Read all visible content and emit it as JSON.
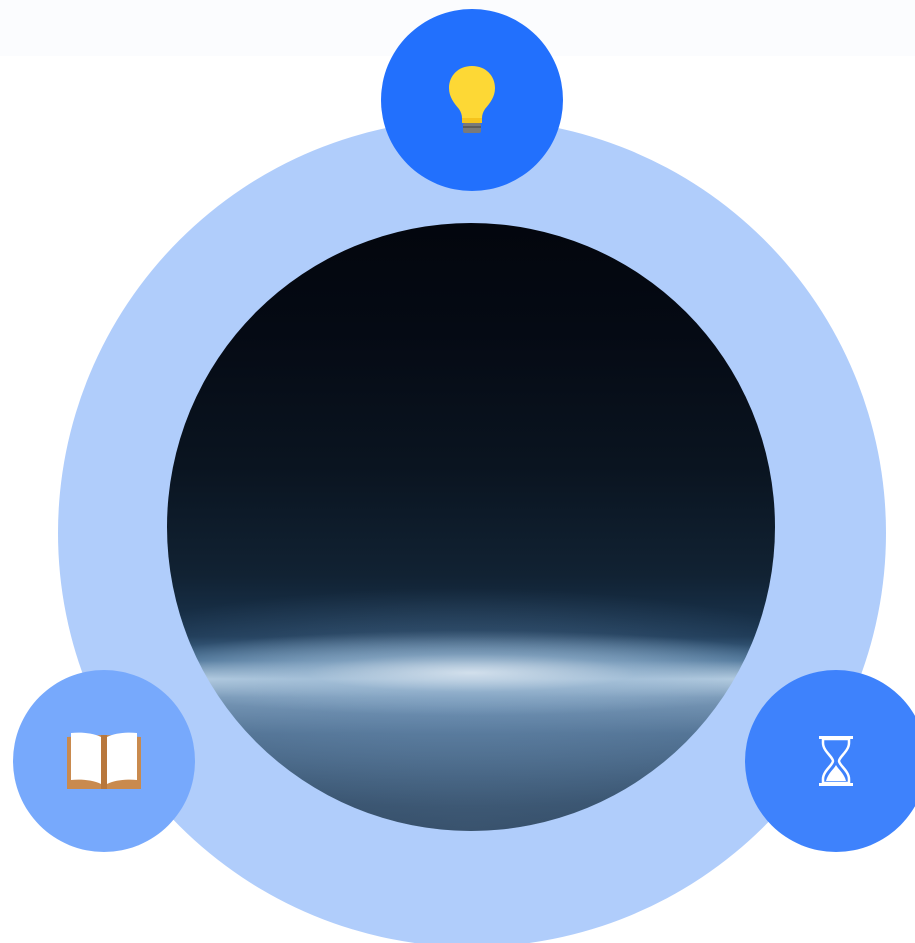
{
  "diagram": {
    "center_image": "earth-horizon-from-space",
    "nodes": [
      {
        "icon": "lightbulb-icon",
        "color": "#2270fd",
        "position": "top"
      },
      {
        "icon": "open-book-icon",
        "color": "#77a9fc",
        "position": "bottom-left"
      },
      {
        "icon": "hourglass-icon",
        "color": "#3e82fc",
        "position": "bottom-right"
      }
    ],
    "ring_color": "#b0cdfb"
  }
}
